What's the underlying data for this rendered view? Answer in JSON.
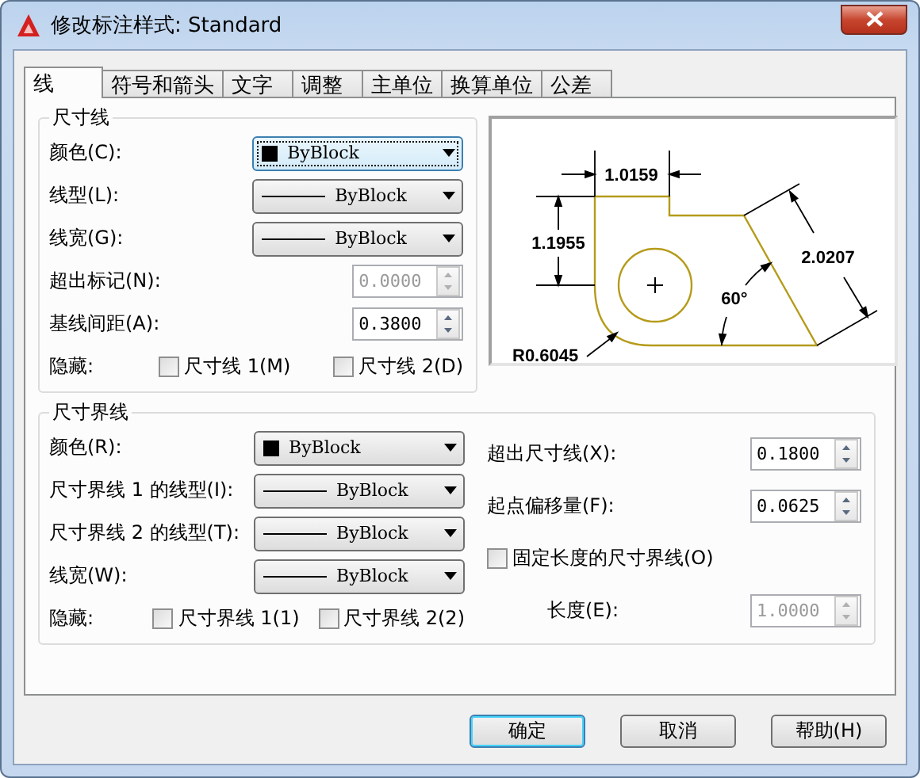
{
  "window": {
    "title": "修改标注样式: Standard"
  },
  "tabs": [
    {
      "label": "线",
      "selected": true
    },
    {
      "label": "符号和箭头",
      "selected": false
    },
    {
      "label": "文字",
      "selected": false
    },
    {
      "label": "调整",
      "selected": false
    },
    {
      "label": "主单位",
      "selected": false
    },
    {
      "label": "换算单位",
      "selected": false
    },
    {
      "label": "公差",
      "selected": false
    }
  ],
  "dimension_lines": {
    "title": "尺寸线",
    "fields": [
      {
        "kind": "color",
        "label": "颜色(C):",
        "value": "ByBlock",
        "focused": true
      },
      {
        "kind": "linetype",
        "label": "线型(L):",
        "value": "ByBlock",
        "focused": false
      },
      {
        "kind": "linetype",
        "label": "线宽(G):",
        "value": "ByBlock",
        "focused": false
      },
      {
        "kind": "spin",
        "label": "超出标记(N):",
        "value": "0.0000",
        "disabled": true
      },
      {
        "kind": "spin",
        "label": "基线间距(A):",
        "value": "0.3800",
        "disabled": false
      }
    ],
    "hide": {
      "label": "隐藏:",
      "options": [
        {
          "label": "尺寸线 1(M)",
          "checked": false
        },
        {
          "label": "尺寸线 2(D)",
          "checked": false
        }
      ]
    }
  },
  "preview": {
    "labels": [
      "1.0159",
      "1.1955",
      "2.0207",
      "60°",
      "R0.6045"
    ]
  },
  "extension_lines": {
    "title": "尺寸界线",
    "fields": [
      {
        "kind": "color",
        "label": "颜色(R):",
        "value": "ByBlock",
        "focused": false
      },
      {
        "kind": "linetype",
        "label": "尺寸界线 1 的线型(I):",
        "value": "ByBlock",
        "focused": false
      },
      {
        "kind": "linetype",
        "label": "尺寸界线 2 的线型(T):",
        "value": "ByBlock",
        "focused": false
      },
      {
        "kind": "linetype",
        "label": "线宽(W):",
        "value": "ByBlock",
        "focused": false
      }
    ],
    "hide": {
      "label": "隐藏:",
      "options": [
        {
          "label": "尺寸界线 1(1)",
          "checked": false
        },
        {
          "label": "尺寸界线 2(2)",
          "checked": false
        }
      ]
    },
    "offsets": [
      {
        "label": "超出尺寸线(X):",
        "value": "0.1800",
        "disabled": false
      },
      {
        "label": "起点偏移量(F):",
        "value": "0.0625",
        "disabled": false
      }
    ],
    "fixed_length": {
      "label": "固定长度的尺寸界线(O)",
      "checked": false
    },
    "length": {
      "label": "长度(E):",
      "value": "1.0000",
      "disabled": true
    }
  },
  "buttons": [
    {
      "label": "确定",
      "default": true
    },
    {
      "label": "取消",
      "default": false
    },
    {
      "label": "帮助(H)",
      "default": false
    }
  ]
}
